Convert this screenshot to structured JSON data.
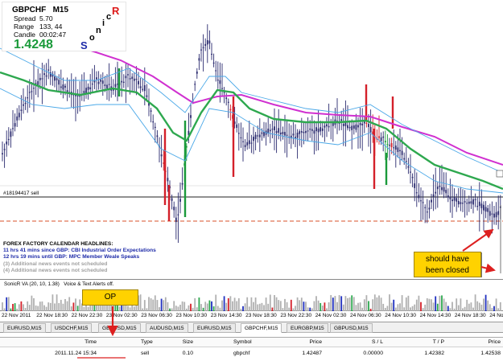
{
  "info_box": {
    "symbol": "GBPCHF",
    "timeframe": "M15",
    "rows": [
      {
        "key": "Spread",
        "value": "5.70"
      },
      {
        "key": "Range",
        "value": "133, 44"
      },
      {
        "key": "Candle",
        "value": "00:02:47"
      }
    ],
    "price": "1.4248",
    "sonic_letters": [
      "S",
      "o",
      "n",
      "i",
      "c",
      "R"
    ]
  },
  "order_line_label": "#18194417 sell",
  "ff_calendar": {
    "title": "FOREX FACTORY CALENDAR HEADLINES:",
    "lines": [
      {
        "text": "11 hrs 41 mins since GBP: CBI Industrial Order Expectations",
        "style": "blue"
      },
      {
        "text": "12 hrs 19 mins until GBP: MPC Member Weale Speaks",
        "style": "blue"
      },
      {
        "text": "(3)  Additional news events not scheduled",
        "style": "gray"
      },
      {
        "text": "(4)  Additional news events not scheduled",
        "style": "gray"
      }
    ]
  },
  "callout": {
    "line1": "should have",
    "line2": "been closed"
  },
  "oscillator": {
    "title": "SonicR VA (20, 10, 1.38)",
    "subtitle": "Voice & Text Alerts off."
  },
  "op_label": "OP",
  "time_axis": [
    "22 Nov 2011",
    "22 Nov 18:30",
    "22 Nov 22:30",
    "23 Nov 02:30",
    "23 Nov 06:30",
    "23 Nov 10:30",
    "23 Nov 14:30",
    "23 Nov 18:30",
    "23 Nov 22:30",
    "24 Nov 02:30",
    "24 Nov 06:30",
    "24 Nov 10:30",
    "24 Nov 14:30",
    "24 Nov 18:30",
    "24 No"
  ],
  "chart_tabs": [
    {
      "label": "EURUSD,M15",
      "active": false
    },
    {
      "label": "USDCHF,M15",
      "active": false
    },
    {
      "label": "GBPUSD,M15",
      "active": false
    },
    {
      "label": "AUDUSD,M15",
      "active": false
    },
    {
      "label": "EURUSD,M15",
      "active": false
    },
    {
      "label": "GBPCHF,M15",
      "active": true
    },
    {
      "label": "EURGBP,M15",
      "active": false
    },
    {
      "label": "GBPUSD,M15",
      "active": false
    }
  ],
  "terminal": {
    "headers": [
      "Time",
      "Type",
      "Size",
      "Symbol",
      "Price",
      "S / L",
      "T / P",
      "Price"
    ],
    "row": [
      "2011.11.24 15:34",
      "sell",
      "0.10",
      "gbpchf",
      "1.42487",
      "0.00000",
      "1.42382",
      "1.42538"
    ]
  },
  "colors": {
    "candle_up": "#1a9a3a",
    "candle_down": "#d4202a",
    "candle_body": "#2a2a6e",
    "ma_green": "#2ea84f",
    "ma_magenta": "#d030d0",
    "ma_blue": "#4aa8e8",
    "callout_bg": "#ffd200",
    "arrow_red": "#dd2020"
  }
}
